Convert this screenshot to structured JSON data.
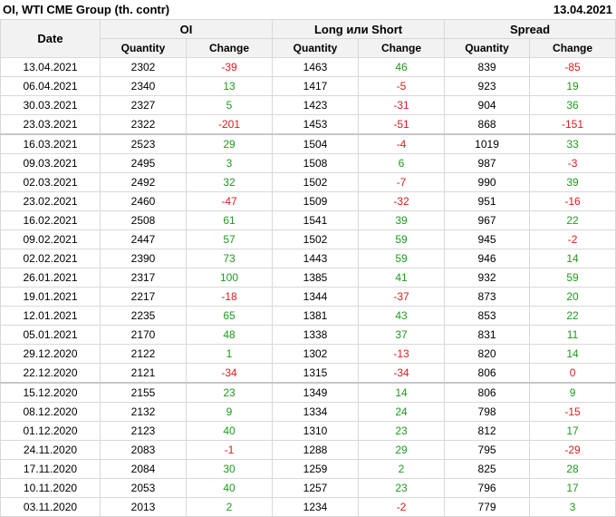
{
  "title": "OI, WTI CME Group (th. contr)",
  "report_date": "13.04.2021",
  "headers": {
    "date": "Date",
    "groups": [
      "OI",
      "Long или Short",
      "Spread"
    ],
    "quantity": "Quantity",
    "change": "Change"
  },
  "colors": {
    "positive": "#1e9a1e",
    "negative": "#d81c1c",
    "header_bg": "#f2f2f2",
    "border": "#d9d9d9"
  },
  "separator_after_rows": [
    3,
    16
  ],
  "rows": [
    [
      "13.04.2021",
      "2302",
      "-39",
      "1463",
      "46",
      "839",
      "-85"
    ],
    [
      "06.04.2021",
      "2340",
      "13",
      "1417",
      "-5",
      "923",
      "19"
    ],
    [
      "30.03.2021",
      "2327",
      "5",
      "1423",
      "-31",
      "904",
      "36"
    ],
    [
      "23.03.2021",
      "2322",
      "-201",
      "1453",
      "-51",
      "868",
      "-151"
    ],
    [
      "16.03.2021",
      "2523",
      "29",
      "1504",
      "-4",
      "1019",
      "33"
    ],
    [
      "09.03.2021",
      "2495",
      "3",
      "1508",
      "6",
      "987",
      "-3"
    ],
    [
      "02.03.2021",
      "2492",
      "32",
      "1502",
      "-7",
      "990",
      "39"
    ],
    [
      "23.02.2021",
      "2460",
      "-47",
      "1509",
      "-32",
      "951",
      "-16"
    ],
    [
      "16.02.2021",
      "2508",
      "61",
      "1541",
      "39",
      "967",
      "22"
    ],
    [
      "09.02.2021",
      "2447",
      "57",
      "1502",
      "59",
      "945",
      "-2"
    ],
    [
      "02.02.2021",
      "2390",
      "73",
      "1443",
      "59",
      "946",
      "14"
    ],
    [
      "26.01.2021",
      "2317",
      "100",
      "1385",
      "41",
      "932",
      "59"
    ],
    [
      "19.01.2021",
      "2217",
      "-18",
      "1344",
      "-37",
      "873",
      "20"
    ],
    [
      "12.01.2021",
      "2235",
      "65",
      "1381",
      "43",
      "853",
      "22"
    ],
    [
      "05.01.2021",
      "2170",
      "48",
      "1338",
      "37",
      "831",
      "11"
    ],
    [
      "29.12.2020",
      "2122",
      "1",
      "1302",
      "-13",
      "820",
      "14"
    ],
    [
      "22.12.2020",
      "2121",
      "-34",
      "1315",
      "-34",
      "806",
      "0"
    ],
    [
      "15.12.2020",
      "2155",
      "23",
      "1349",
      "14",
      "806",
      "9"
    ],
    [
      "08.12.2020",
      "2132",
      "9",
      "1334",
      "24",
      "798",
      "-15"
    ],
    [
      "01.12.2020",
      "2123",
      "40",
      "1310",
      "23",
      "812",
      "17"
    ],
    [
      "24.11.2020",
      "2083",
      "-1",
      "1288",
      "29",
      "795",
      "-29"
    ],
    [
      "17.11.2020",
      "2084",
      "30",
      "1259",
      "2",
      "825",
      "28"
    ],
    [
      "10.11.2020",
      "2053",
      "40",
      "1257",
      "23",
      "796",
      "17"
    ],
    [
      "03.11.2020",
      "2013",
      "2",
      "1234",
      "-2",
      "779",
      "3"
    ]
  ]
}
